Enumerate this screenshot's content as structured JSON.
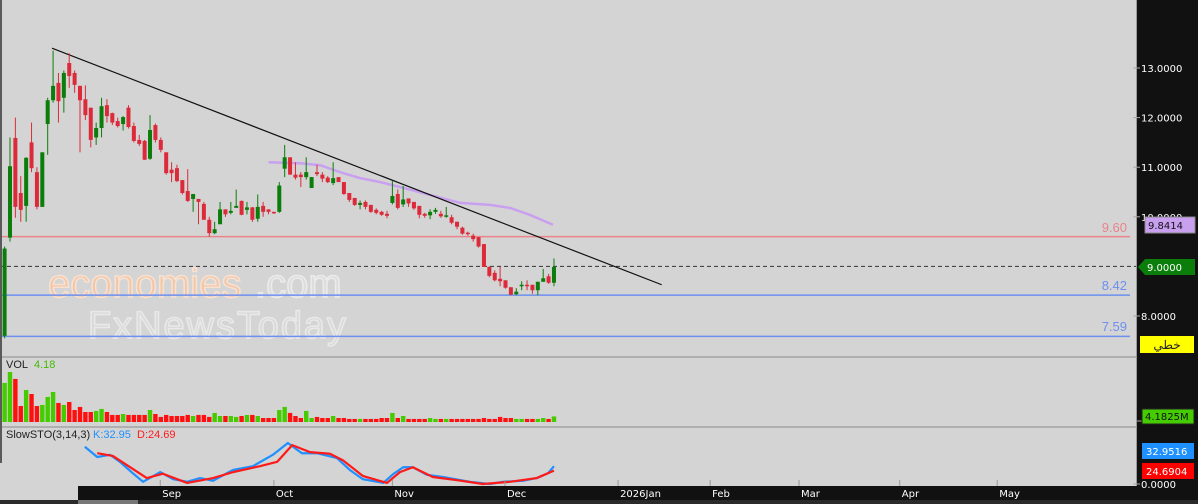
{
  "chart_data": {
    "type": "candlestick",
    "price_axis": {
      "ticks": [
        "13.0000",
        "12.0000",
        "11.0000",
        "10.0000",
        "8.0000"
      ],
      "tick_values": [
        13,
        12,
        11,
        10,
        8
      ]
    },
    "time_axis": {
      "ticks": [
        {
          "label": "Sep",
          "index": 28.9
        },
        {
          "label": "Oct",
          "index": 50
        },
        {
          "label": "Nov",
          "index": 72
        },
        {
          "label": "Dec",
          "index": 92.9
        },
        {
          "label": "2026Jan",
          "index": 113.9
        },
        {
          "label": "Feb",
          "index": 131
        },
        {
          "label": "Mar",
          "index": 147.5
        },
        {
          "label": "Apr",
          "index": 166.2
        },
        {
          "label": "May",
          "index": 184.3
        }
      ]
    },
    "candles_ohlc": [
      [
        7.6,
        9.4,
        7.55,
        9.36
      ],
      [
        9.58,
        11.6,
        9.5,
        11.02
      ],
      [
        11.59,
        12.0,
        9.98,
        10.2
      ],
      [
        10.48,
        10.82,
        9.9,
        10.14
      ],
      [
        10.22,
        11.2,
        9.9,
        11.19
      ],
      [
        11.5,
        11.9,
        10.9,
        10.98
      ],
      [
        10.9,
        11.0,
        10.15,
        10.2
      ],
      [
        10.2,
        11.3,
        10.2,
        11.3
      ],
      [
        11.87,
        12.4,
        11.25,
        12.35
      ],
      [
        12.35,
        13.35,
        12.3,
        12.64
      ],
      [
        12.7,
        12.9,
        11.9,
        12.33
      ],
      [
        12.4,
        12.95,
        12.1,
        12.9
      ],
      [
        13.1,
        13.3,
        12.6,
        12.84
      ],
      [
        12.9,
        12.95,
        12.5,
        12.66
      ],
      [
        12.64,
        12.64,
        11.3,
        12.35
      ],
      [
        12.37,
        12.65,
        11.95,
        12.05
      ],
      [
        12.2,
        12.2,
        11.4,
        11.55
      ],
      [
        11.6,
        11.9,
        11.45,
        11.79
      ],
      [
        11.79,
        12.4,
        11.6,
        12.23
      ],
      [
        12.25,
        12.37,
        11.9,
        12.03
      ],
      [
        12.09,
        12.1,
        11.85,
        11.9
      ],
      [
        11.93,
        12.0,
        11.8,
        11.83
      ],
      [
        11.87,
        12.03,
        11.74,
        12.01
      ],
      [
        12.2,
        12.25,
        11.78,
        11.81
      ],
      [
        11.83,
        11.9,
        11.5,
        11.53
      ],
      [
        11.55,
        11.65,
        11.43,
        11.47
      ],
      [
        11.53,
        11.55,
        11.15,
        11.15
      ],
      [
        11.17,
        12.05,
        11.15,
        11.75
      ],
      [
        11.85,
        11.88,
        11.5,
        11.55
      ],
      [
        11.55,
        11.6,
        11.3,
        11.35
      ],
      [
        11.3,
        11.3,
        10.85,
        10.88
      ],
      [
        10.95,
        11.1,
        10.7,
        10.88
      ],
      [
        10.98,
        11.05,
        10.7,
        10.72
      ],
      [
        10.74,
        10.74,
        10.45,
        10.48
      ],
      [
        10.52,
        10.96,
        10.3,
        10.32
      ],
      [
        10.36,
        10.46,
        10.1,
        10.46
      ],
      [
        10.36,
        10.36,
        9.85,
        10.3
      ],
      [
        10.26,
        10.3,
        9.94,
        9.94
      ],
      [
        9.94,
        10.0,
        9.6,
        9.67
      ],
      [
        9.67,
        9.9,
        9.65,
        9.75
      ],
      [
        9.85,
        10.3,
        9.85,
        10.15
      ],
      [
        10.15,
        10.15,
        10.0,
        10.05
      ],
      [
        10.08,
        10.3,
        10.05,
        10.12
      ],
      [
        10.18,
        10.55,
        10.2,
        10.22
      ],
      [
        10.32,
        10.33,
        10.03,
        10.04
      ],
      [
        10.14,
        10.3,
        10.05,
        10.19
      ],
      [
        10.19,
        10.2,
        9.9,
        9.94
      ],
      [
        9.96,
        10.45,
        9.9,
        10.2
      ],
      [
        10.22,
        10.3,
        10.0,
        10.1
      ],
      [
        10.15,
        10.15,
        10.05,
        10.1
      ],
      [
        10.1,
        10.1,
        10.06,
        10.07
      ],
      [
        10.1,
        10.7,
        10.08,
        10.63
      ],
      [
        10.97,
        11.45,
        10.8,
        11.2
      ],
      [
        11.2,
        11.2,
        10.85,
        10.85
      ],
      [
        10.85,
        11.1,
        10.75,
        10.79
      ],
      [
        10.85,
        10.9,
        10.6,
        10.8
      ],
      [
        10.8,
        11.2,
        10.75,
        10.9
      ],
      [
        10.58,
        10.8,
        10.58,
        10.8
      ],
      [
        10.9,
        11.05,
        10.82,
        10.86
      ],
      [
        10.85,
        10.9,
        10.7,
        10.77
      ],
      [
        10.79,
        10.82,
        10.68,
        10.7
      ],
      [
        10.68,
        11.1,
        10.64,
        10.78
      ],
      [
        10.8,
        10.8,
        10.7,
        10.7
      ],
      [
        10.7,
        10.7,
        10.44,
        10.46
      ],
      [
        10.48,
        10.48,
        10.3,
        10.34
      ],
      [
        10.38,
        10.38,
        10.22,
        10.24
      ],
      [
        10.24,
        10.33,
        10.15,
        10.28
      ],
      [
        10.3,
        10.33,
        10.15,
        10.2
      ],
      [
        10.24,
        10.24,
        10.08,
        10.1
      ],
      [
        10.14,
        10.17,
        10.05,
        10.08
      ],
      [
        10.1,
        10.12,
        10.02,
        10.04
      ],
      [
        10.06,
        10.12,
        9.97,
        10.02
      ],
      [
        10.28,
        10.72,
        10.25,
        10.42
      ],
      [
        10.46,
        10.55,
        10.15,
        10.18
      ],
      [
        10.25,
        10.62,
        10.2,
        10.35
      ],
      [
        10.37,
        10.37,
        10.2,
        10.27
      ],
      [
        10.3,
        10.3,
        10.14,
        10.17
      ],
      [
        10.22,
        10.22,
        9.97,
        10.04
      ],
      [
        10.06,
        10.08,
        9.98,
        10.02
      ],
      [
        10.03,
        10.15,
        9.95,
        10.1
      ],
      [
        10.1,
        10.18,
        10.06,
        10.14
      ],
      [
        10.06,
        10.12,
        9.98,
        10.01
      ],
      [
        10.0,
        10.2,
        9.98,
        10.03
      ],
      [
        9.99,
        10.04,
        9.85,
        9.88
      ],
      [
        9.9,
        9.9,
        9.75,
        9.8
      ],
      [
        9.78,
        9.8,
        9.64,
        9.66
      ],
      [
        9.68,
        9.7,
        9.62,
        9.65
      ],
      [
        9.62,
        9.66,
        9.5,
        9.55
      ],
      [
        9.59,
        9.59,
        9.38,
        9.4
      ],
      [
        9.45,
        9.45,
        8.99,
        8.99
      ],
      [
        8.99,
        9.0,
        8.78,
        8.81
      ],
      [
        8.87,
        8.92,
        8.7,
        8.72
      ],
      [
        8.75,
        9.0,
        8.6,
        8.7
      ],
      [
        8.72,
        8.72,
        8.55,
        8.57
      ],
      [
        8.58,
        8.58,
        8.42,
        8.43
      ],
      [
        8.44,
        8.56,
        8.42,
        8.49
      ],
      [
        8.6,
        8.7,
        8.52,
        8.63
      ],
      [
        8.63,
        8.72,
        8.52,
        8.6
      ],
      [
        8.63,
        8.63,
        8.45,
        8.52
      ],
      [
        8.52,
        8.69,
        8.42,
        8.69
      ],
      [
        8.69,
        8.95,
        8.69,
        8.76
      ],
      [
        8.8,
        8.85,
        8.65,
        8.67
      ],
      [
        8.67,
        9.16,
        8.6,
        8.99
      ]
    ],
    "moving_average": [
      [
        49,
        11.1
      ],
      [
        54.9,
        11.08
      ],
      [
        58.6,
        11.04
      ],
      [
        62.3,
        10.9
      ],
      [
        66,
        10.78
      ],
      [
        69.7,
        10.7
      ],
      [
        73.4,
        10.6
      ],
      [
        79,
        10.44
      ],
      [
        84.6,
        10.28
      ],
      [
        90.1,
        10.24
      ],
      [
        93.8,
        10.18
      ],
      [
        97.5,
        10.04
      ],
      [
        101.8,
        9.84
      ]
    ],
    "trendline": [
      [
        8.8,
        13.4
      ],
      [
        122,
        8.63
      ]
    ],
    "levels": [
      {
        "label": "9.60",
        "value": 9.6,
        "color": "#e8848a"
      },
      {
        "label": "8.42",
        "value": 8.42,
        "color": "#6c8ff0"
      },
      {
        "label": "7.59",
        "value": 7.59,
        "color": "#6c8ff0"
      }
    ],
    "last_price": {
      "label": "9.0000",
      "value": 9.0
    },
    "ma_tag": "9.8414",
    "line_type_label": "خطي",
    "volume": {
      "title": "VOL",
      "value_label": "4.18",
      "last_tag": "4.1825M",
      "unit": "M",
      "values": [
        29.3,
        37.5,
        32.3,
        12,
        24,
        21,
        12,
        12.8,
        18.8,
        22.5,
        14.3,
        12.8,
        15,
        9,
        11.3,
        7.5,
        7.5,
        8.3,
        9.8,
        7.5,
        5.3,
        5.3,
        6,
        5.3,
        5.3,
        5.3,
        5.3,
        9,
        6,
        3.8,
        5.3,
        4.5,
        4.5,
        4.5,
        5.3,
        4.5,
        5.3,
        5.3,
        3.8,
        6.8,
        4.5,
        4.5,
        4.5,
        3.8,
        4.5,
        5.3,
        5.3,
        4.5,
        3,
        3,
        3,
        9,
        11.3,
        6.8,
        4.5,
        3,
        8.3,
        3,
        3.8,
        3,
        3,
        4.5,
        3,
        3,
        2.3,
        2.3,
        2.3,
        2.3,
        2.3,
        2.3,
        3,
        3,
        6.8,
        3,
        4.5,
        2.3,
        2.3,
        2.3,
        2.3,
        3,
        2.3,
        2.3,
        2.3,
        2.3,
        2.3,
        2.3,
        2.3,
        2.3,
        2.3,
        3,
        2.3,
        2.3,
        3.8,
        3,
        3,
        2.3,
        2.3,
        2.3,
        2.3,
        2.3,
        3,
        2.3,
        4.18
      ]
    },
    "stochastic": {
      "title": "SlowSTO(3,14,3)",
      "k_label": "K:32.95",
      "d_label": "D:24.69",
      "k_tag": "32.9516",
      "d_tag": "24.6904",
      "zero_tag": "0.0000",
      "k": [
        [
          14.9,
          69
        ],
        [
          17.2,
          50
        ],
        [
          19.6,
          54
        ],
        [
          21.4,
          41
        ],
        [
          23.8,
          20
        ],
        [
          25.7,
          4
        ],
        [
          28.9,
          22
        ],
        [
          31.3,
          9
        ],
        [
          33.9,
          4
        ],
        [
          36.3,
          11
        ],
        [
          38.7,
          6
        ],
        [
          42.4,
          26
        ],
        [
          46.1,
          33
        ],
        [
          49.8,
          54
        ],
        [
          52.6,
          76
        ],
        [
          55.2,
          57
        ],
        [
          58,
          57
        ],
        [
          61.7,
          48
        ],
        [
          64.1,
          26
        ],
        [
          66.5,
          9
        ],
        [
          70.3,
          2
        ],
        [
          72.1,
          18
        ],
        [
          74,
          31
        ],
        [
          75.8,
          31
        ],
        [
          78.4,
          17
        ],
        [
          81.4,
          13
        ],
        [
          86.4,
          4
        ],
        [
          90.1,
          0
        ],
        [
          92.5,
          4
        ],
        [
          96.2,
          6
        ],
        [
          98.8,
          11
        ],
        [
          100.9,
          20
        ],
        [
          102,
          32.95
        ]
      ],
      "d": [
        [
          17.2,
          57
        ],
        [
          20.1,
          52
        ],
        [
          22.7,
          35
        ],
        [
          26.4,
          11
        ],
        [
          29.4,
          19
        ],
        [
          33.9,
          2
        ],
        [
          38.7,
          11
        ],
        [
          42.4,
          22
        ],
        [
          47.4,
          33
        ],
        [
          50.6,
          41
        ],
        [
          53.4,
          72
        ],
        [
          56.7,
          59
        ],
        [
          60.4,
          56
        ],
        [
          62.8,
          44
        ],
        [
          66.5,
          15
        ],
        [
          71,
          2
        ],
        [
          73.4,
          22
        ],
        [
          75.8,
          31
        ],
        [
          79.5,
          13
        ],
        [
          84,
          7
        ],
        [
          88.8,
          0
        ],
        [
          93.8,
          4
        ],
        [
          98.8,
          11
        ],
        [
          102,
          24.69
        ]
      ],
      "k_color": "#1e90ff",
      "d_color": "#ff1a1a"
    },
    "colors": {
      "up": "#0a7d0a",
      "down": "#dc2a3a",
      "vol_up": "#44cc00",
      "vol_down": "#ff1010",
      "ma": "#c9a0f0",
      "background": "#d4d4d4",
      "axis_bg": "#111111"
    },
    "watermark": {
      "line1a": "economies",
      "line1b": ".com",
      "line2": "FxNewsToday"
    }
  }
}
